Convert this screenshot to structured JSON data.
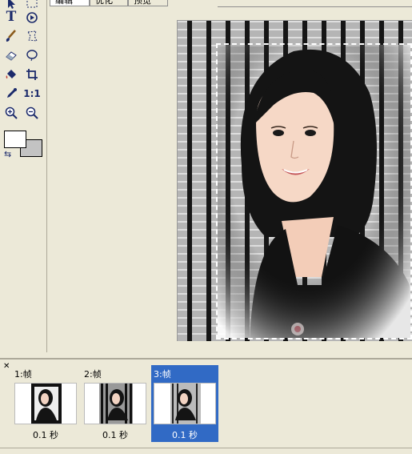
{
  "tabs": [
    {
      "label": "编辑",
      "active": true
    },
    {
      "label": "优化",
      "active": false
    },
    {
      "label": "预览",
      "active": false
    }
  ],
  "toolbox": {
    "tools": [
      "pointer-icon",
      "marquee-icon",
      "text-tool-icon",
      "rotate-icon",
      "brush-icon",
      "lasso-icon",
      "eraser-icon",
      "ellipse-select-icon",
      "paint-bucket-icon",
      "crop-icon",
      "eyedropper-icon",
      "actual-size-icon",
      "zoom-in-icon",
      "zoom-out-icon"
    ],
    "text_glyph": "T",
    "ratio_glyph": "1:1",
    "foreground_color": "#ffffff",
    "background_color": "#c3c3c3"
  },
  "frames": [
    {
      "label": "1:帧",
      "delay": "0.1 秒",
      "selected": false
    },
    {
      "label": "2:帧",
      "delay": "0.1 秒",
      "selected": false
    },
    {
      "label": "3:帧",
      "delay": "0.1 秒",
      "selected": true
    }
  ],
  "colors": {
    "selection": "#316ac5",
    "panel": "#ece9d8"
  }
}
